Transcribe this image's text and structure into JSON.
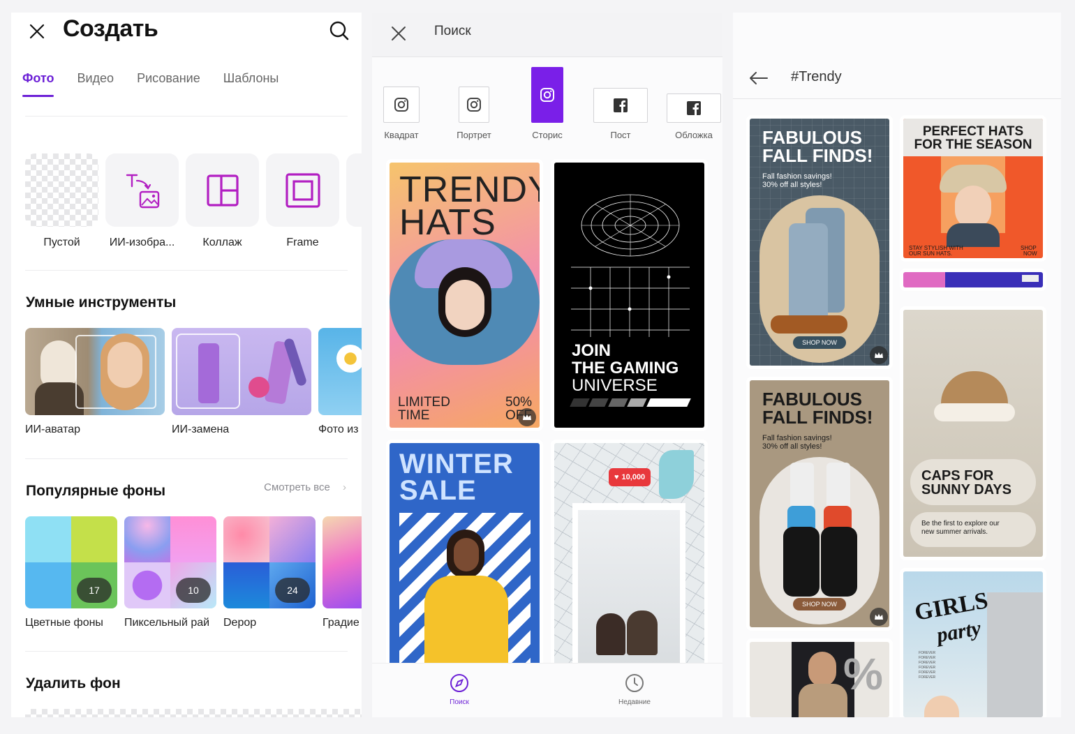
{
  "create_panel": {
    "title": "Создать",
    "tabs": [
      "Фото",
      "Видео",
      "Рисование",
      "Шаблоны"
    ],
    "active_tab": "Фото",
    "create_items": [
      "Пустой",
      "ИИ-изобра...",
      "Коллаж",
      "Frame"
    ],
    "smart_tools_title": "Умные инструменты",
    "smart_tools": [
      "ИИ-аватар",
      "ИИ-замена",
      "Фото из"
    ],
    "popular_bg_title": "Популярные фоны",
    "see_all": "Смотреть все",
    "backgrounds": [
      {
        "label": "Цветные фоны",
        "count": "17"
      },
      {
        "label": "Пиксельный рай",
        "count": "10"
      },
      {
        "label": "Depop",
        "count": "24"
      },
      {
        "label": "Градие",
        "count": ""
      }
    ],
    "remove_bg_title": "Удалить фон"
  },
  "search_panel": {
    "title": "Поиск",
    "formats": [
      "Квадрат",
      "Портрет",
      "Сторис",
      "Пост",
      "Обложка"
    ],
    "active_format": "Сторис",
    "templates": {
      "t1": {
        "headline": "TRENDY HATS",
        "line1": "LIMITED",
        "line2": "TIME",
        "badge1": "50%",
        "badge2": "OFF"
      },
      "t2": {
        "line1": "JOIN",
        "line2": "THE GAMING",
        "line3": "UNIVERSE"
      },
      "t3": {
        "line1": "WINTER",
        "line2": "SALE"
      },
      "t4": {
        "likes": "10,000"
      }
    },
    "nav": [
      "Поиск",
      "Недавние"
    ],
    "active_nav": "Поиск"
  },
  "trendy_panel": {
    "title": "#Trendy",
    "templates": {
      "a": {
        "h1": "FABULOUS",
        "h2": "FALL FINDS!",
        "sub1": "Fall fashion savings!",
        "sub2": "30% off all styles!",
        "cta": "SHOP NOW"
      },
      "b": {
        "h1": "PERFECT HATS",
        "h2": "FOR THE SEASON",
        "foot1": "STAY STYLISH WITH",
        "foot2": "OUR SUN HATS.",
        "foot3": "SHOP",
        "foot4": "NOW"
      },
      "c": {
        "h1": "FABULOUS",
        "h2": "FALL FINDS!",
        "sub1": "Fall fashion savings!",
        "sub2": "30% off all styles!",
        "cta": "SHOP NOW"
      },
      "d": {
        "h1": "CAPS FOR",
        "h2": "SUNNY DAYS",
        "sub1": "Be the first to explore our",
        "sub2": "new summer arrivals."
      },
      "e": {
        "h1": "GIRLS",
        "h2": "party",
        "rep": "FOREVER"
      }
    }
  },
  "colors": {
    "accent": "#6b1fd6",
    "story_active": "#7a1fe8"
  }
}
